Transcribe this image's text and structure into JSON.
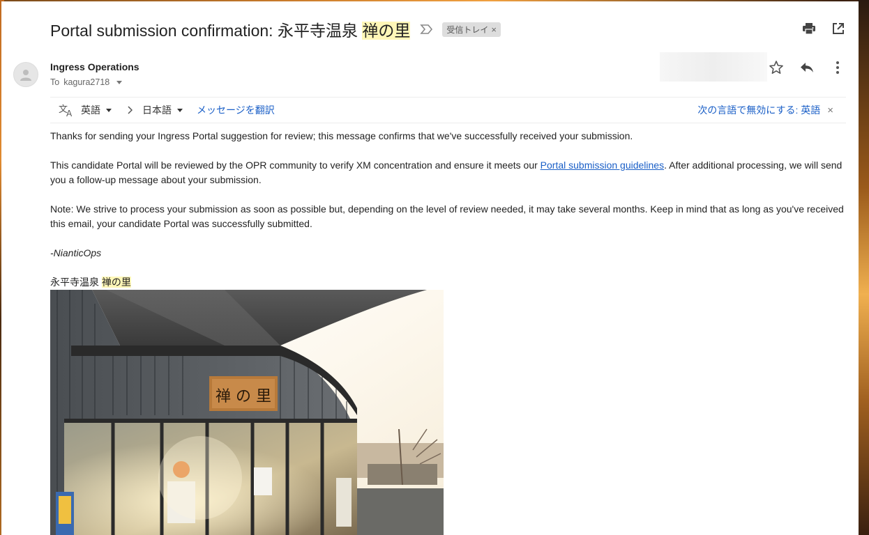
{
  "email": {
    "subject_prefix": "Portal submission confirmation: 永平寺温泉 ",
    "subject_highlight": "禅の里",
    "label": "受信トレイ",
    "label_close": "×",
    "sender": "Ingress Operations",
    "to_prefix": "To",
    "to_recipient": "kagura2718"
  },
  "translate": {
    "from_lang": "英語",
    "to_lang": "日本語",
    "translate_link": "メッセージを翻訳",
    "disable_text": "次の言語で無効にする: 英語",
    "close": "×"
  },
  "body": {
    "p1": "Thanks for sending your Ingress Portal suggestion for review; this message confirms that we've successfully received your submission.",
    "p2_before": "This candidate Portal will be reviewed by the OPR community to verify XM concentration and ensure it meets our ",
    "p2_link": "Portal submission guidelines",
    "p2_after": ". After additional processing, we will send you a follow-up message about your submission.",
    "p3": "Note: We strive to process your submission as soon as possible but, depending on the level of review needed, it may take several months. Keep in mind that as long as you've received this email, your candidate Portal was successfully submitted.",
    "signature": "-NianticOps",
    "portal_name_prefix": "永平寺温泉 ",
    "portal_name_highlight": "禅の里"
  },
  "photo": {
    "sign_text": "禅 の 里"
  },
  "icons": {
    "important": "important-marker-icon",
    "print": "print-icon",
    "open_new_window": "open-in-new-window-icon",
    "avatar": "default-avatar-icon",
    "star": "star-icon",
    "reply": "reply-icon",
    "more": "more-vertical-icon",
    "translate": "translate-icon",
    "chevron": "chevron-right-icon"
  },
  "colors": {
    "link": "#1a5fc7",
    "highlight": "#fff7b8",
    "label_bg": "#dddddd"
  }
}
